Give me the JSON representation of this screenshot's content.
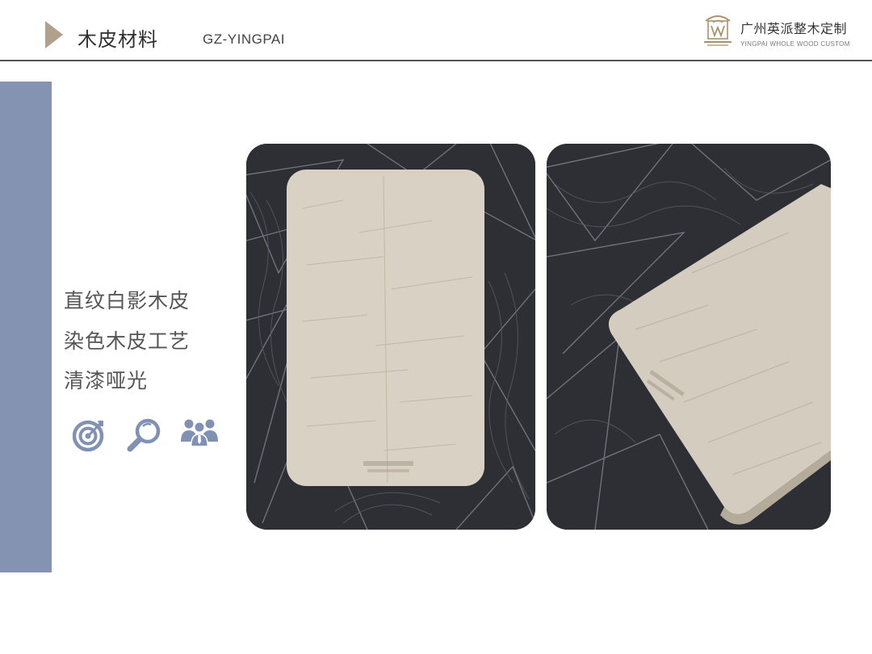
{
  "header": {
    "title": "木皮材料",
    "subtitle": "GZ-YINGPAI",
    "brand": {
      "name": "广州英派整木定制",
      "tagline": "YINGPAI WHOLE WOOD CUSTOM"
    }
  },
  "features": [
    {
      "label": "直纹白影木皮"
    },
    {
      "label": "染色木皮工艺"
    },
    {
      "label": "清漆哑光"
    }
  ],
  "icons": [
    "target-icon",
    "magnifier-icon",
    "team-icon"
  ],
  "colors": {
    "accent_bar": "#8593b2",
    "icon_blue": "#8191b4",
    "arrow": "#b0a08e",
    "wood": "#d8d1c4",
    "background_stone": "#2e2f35"
  },
  "photos": [
    {
      "name": "veneer-sample-front"
    },
    {
      "name": "veneer-sample-angled"
    }
  ]
}
